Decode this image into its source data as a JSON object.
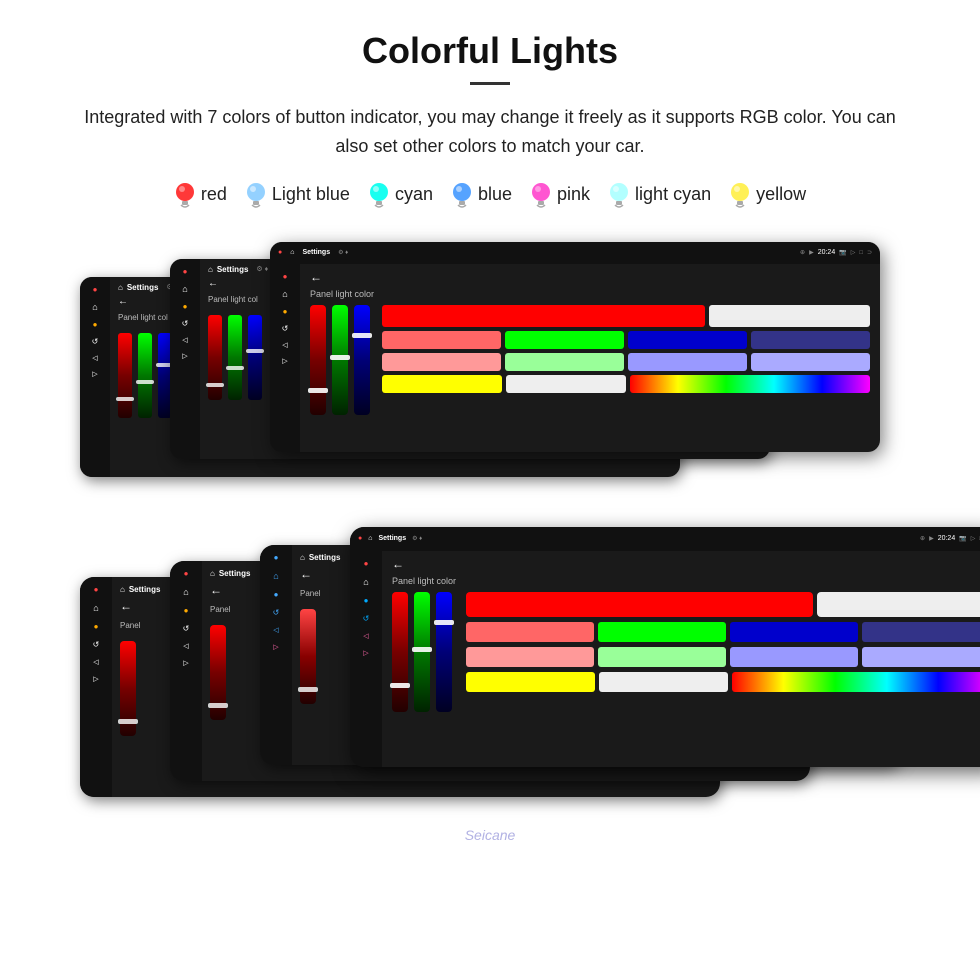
{
  "header": {
    "title": "Colorful Lights",
    "description": "Integrated with 7 colors of button indicator, you may change it freely as it supports RGB color. You can also set other colors to match your car.",
    "watermark": "Seicane"
  },
  "colors": [
    {
      "name": "red",
      "color": "#ff2222",
      "bulb": "red"
    },
    {
      "name": "Light blue",
      "color": "#88ccff",
      "bulb": "lightblue"
    },
    {
      "name": "cyan",
      "color": "#00ffee",
      "bulb": "cyan"
    },
    {
      "name": "blue",
      "color": "#4499ff",
      "bulb": "blue"
    },
    {
      "name": "pink",
      "color": "#ff44cc",
      "bulb": "pink"
    },
    {
      "name": "light cyan",
      "color": "#aaffff",
      "bulb": "lightcyan"
    },
    {
      "name": "yellow",
      "color": "#ffee44",
      "bulb": "yellow"
    }
  ],
  "device_rows": {
    "top_label": "Panel light color",
    "bottom_label": "Panel light color"
  }
}
